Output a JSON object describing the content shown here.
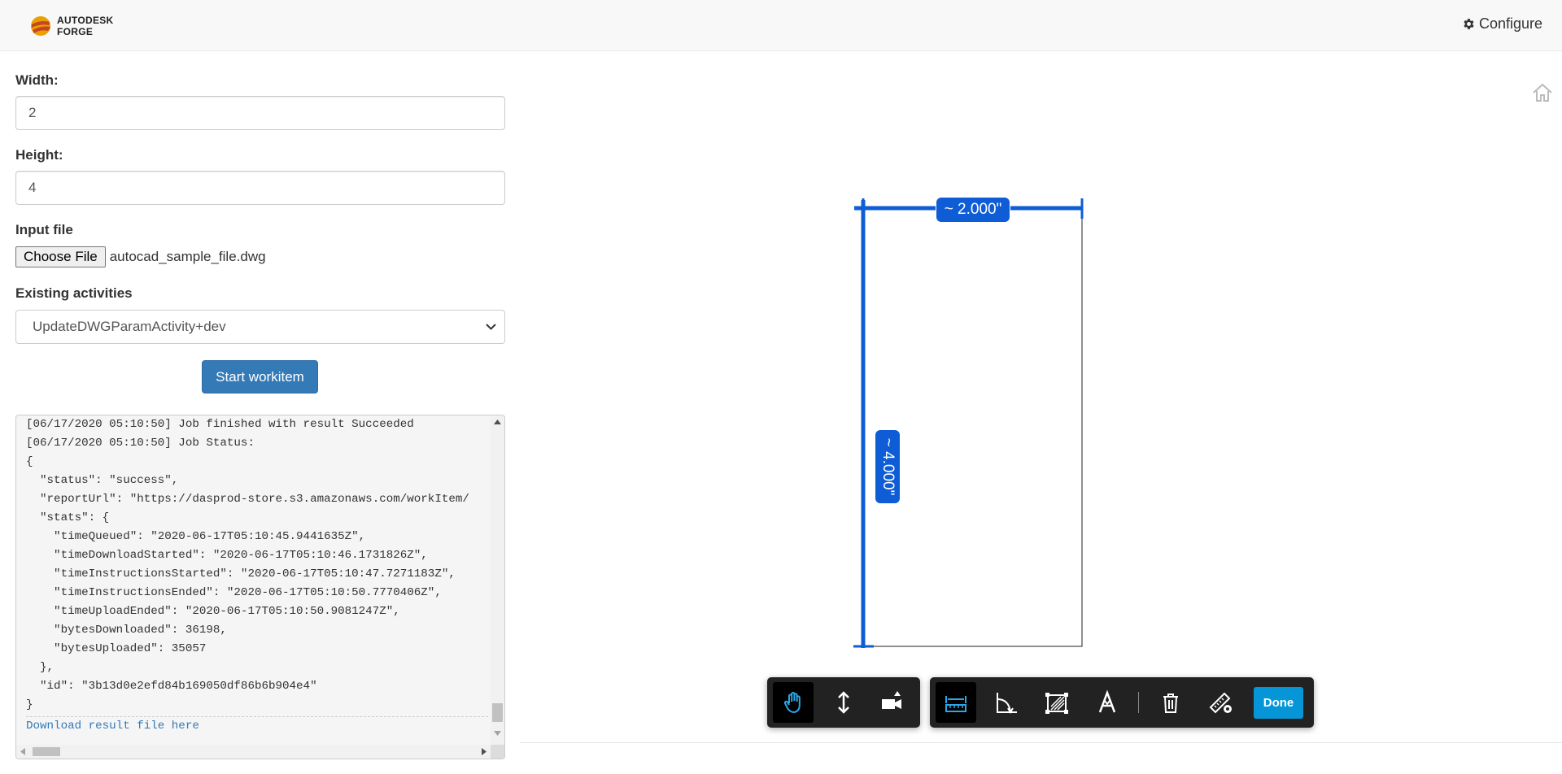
{
  "header": {
    "brand_line1": "AUTODESK",
    "brand_line2": "FORGE",
    "configure_label": "Configure"
  },
  "form": {
    "width_label": "Width:",
    "width_value": "2",
    "height_label": "Height:",
    "height_value": "4",
    "input_file_label": "Input file",
    "choose_file_label": "Choose File",
    "file_name": "autocad_sample_file.dwg",
    "activities_label": "Existing activities",
    "activity_selected": "UpdateDWGParamActivity+dev",
    "start_button": "Start workitem"
  },
  "log": {
    "lines": [
      "[06/17/2020 05:10:50] Job finished with result Succeeded",
      "[06/17/2020 05:10:50] Job Status:",
      "{",
      "  \"status\": \"success\",",
      "  \"reportUrl\": \"https://dasprod-store.s3.amazonaws.com/workItem/",
      "  \"stats\": {",
      "    \"timeQueued\": \"2020-06-17T05:10:45.9441635Z\",",
      "    \"timeDownloadStarted\": \"2020-06-17T05:10:46.1731826Z\",",
      "    \"timeInstructionsStarted\": \"2020-06-17T05:10:47.7271183Z\",",
      "    \"timeInstructionsEnded\": \"2020-06-17T05:10:50.7770406Z\",",
      "    \"timeUploadEnded\": \"2020-06-17T05:10:50.9081247Z\",",
      "    \"bytesDownloaded\": 36198,",
      "    \"bytesUploaded\": 35057",
      "  },",
      "  \"id\": \"3b13d0e2efd84b169050df86b6b904e4\"",
      "}"
    ],
    "download_link": "Download result file here"
  },
  "viewer": {
    "measure_width": "~ 2.000\"",
    "measure_height": "~ 4.000\"",
    "done_label": "Done",
    "accent_color": "#0e5dd6"
  }
}
